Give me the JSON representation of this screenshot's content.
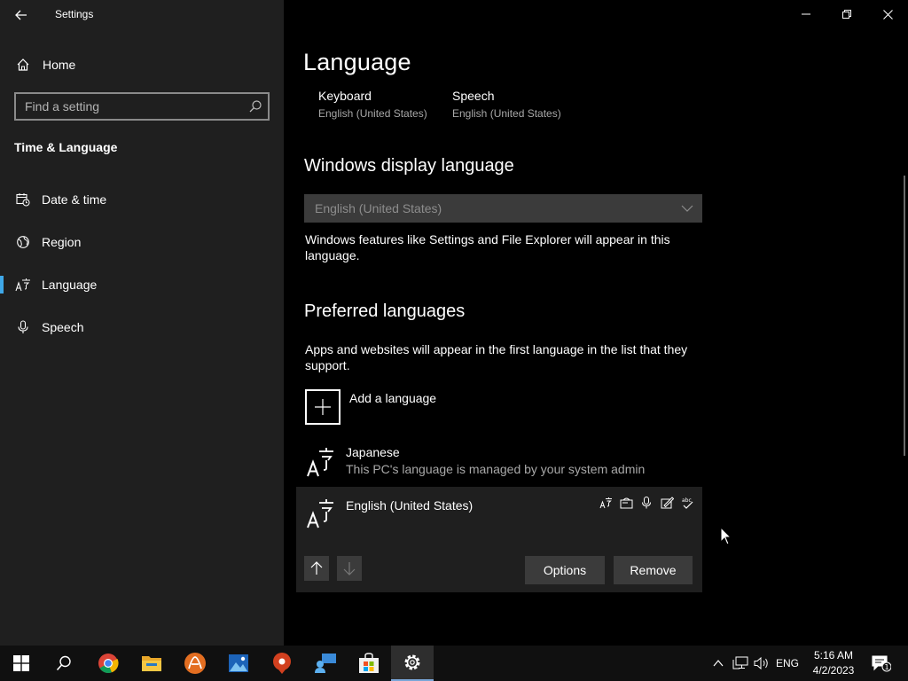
{
  "window": {
    "app_title": "Settings"
  },
  "sidebar": {
    "home_label": "Home",
    "search_placeholder": "Find a setting",
    "section_heading": "Time & Language",
    "items": [
      {
        "label": "Date & time",
        "icon": "calendar-clock-icon"
      },
      {
        "label": "Region",
        "icon": "globe-icon"
      },
      {
        "label": "Language",
        "icon": "language-icon",
        "active": true
      },
      {
        "label": "Speech",
        "icon": "microphone-icon"
      }
    ],
    "accent_color": "#3fa8e8"
  },
  "main": {
    "title": "Language",
    "quick_links": [
      {
        "title": "Keyboard",
        "subtitle": "English (United States)"
      },
      {
        "title": "Speech",
        "subtitle": "English (United States)"
      }
    ],
    "display_language": {
      "heading": "Windows display language",
      "selected": "English (United States)",
      "description": "Windows features like Settings and File Explorer will appear in this language."
    },
    "preferred": {
      "heading": "Preferred languages",
      "description": "Apps and websites will appear in the first language in the list that they support.",
      "add_label": "Add a language",
      "languages": [
        {
          "name": "Japanese",
          "note": "This PC's language is managed by your system admin"
        },
        {
          "name": "English (United States)",
          "feature_icons": [
            "display-language-icon",
            "text-to-speech-icon",
            "speech-recognition-icon",
            "handwriting-icon",
            "spell-check-icon"
          ]
        }
      ],
      "options_label": "Options",
      "remove_label": "Remove"
    }
  },
  "taskbar": {
    "apps": [
      "start-icon",
      "search-icon",
      "chrome-icon",
      "file-explorer-icon",
      "app-icon",
      "photos-icon",
      "maps-icon",
      "feedback-icon",
      "store-icon",
      "settings-icon"
    ],
    "tray": {
      "language": "ENG",
      "time": "5:16 AM",
      "date": "4/2/2023",
      "notification_count": "1"
    }
  }
}
